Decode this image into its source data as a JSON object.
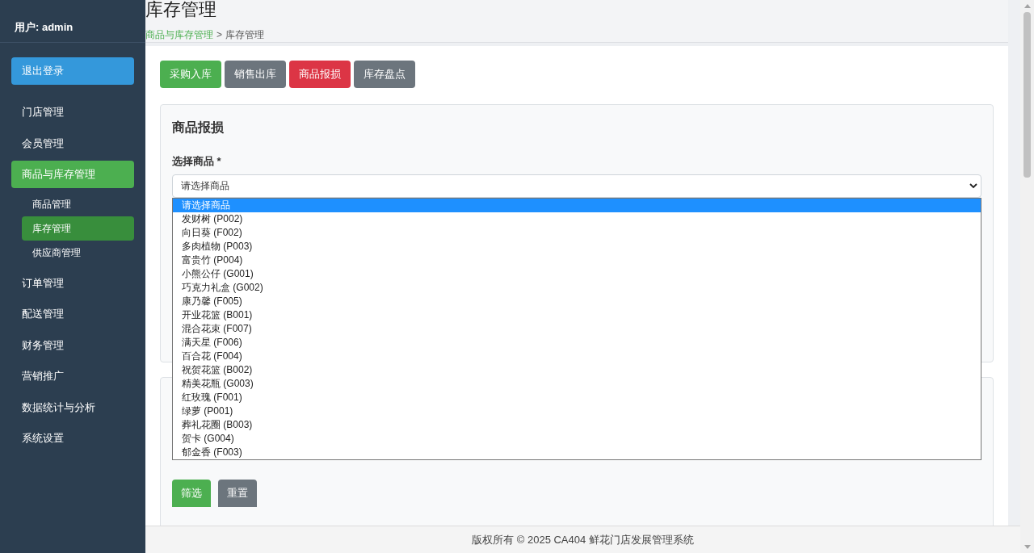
{
  "sidebar": {
    "user": "用户: admin",
    "logout": "退出登录",
    "items": [
      {
        "label": "门店管理",
        "selected": false
      },
      {
        "label": "会员管理",
        "selected": false
      },
      {
        "label": "商品与库存管理",
        "selected": true,
        "children": [
          {
            "label": "商品管理",
            "selected": false
          },
          {
            "label": "库存管理",
            "selected": true
          },
          {
            "label": "供应商管理",
            "selected": false
          }
        ]
      },
      {
        "label": "订单管理",
        "selected": false
      },
      {
        "label": "配送管理",
        "selected": false
      },
      {
        "label": "财务管理",
        "selected": false
      },
      {
        "label": "营销推广",
        "selected": false
      },
      {
        "label": "数据统计与分析",
        "selected": false
      },
      {
        "label": "系统设置",
        "selected": false
      }
    ]
  },
  "header": {
    "title": "库存管理",
    "breadcrumb": [
      {
        "label": "商品与库存管理",
        "kind": "link"
      },
      {
        "label": ">",
        "kind": "separator"
      },
      {
        "label": "库存管理",
        "kind": "current"
      }
    ]
  },
  "actions": [
    {
      "label": "采购入库",
      "color": "#4caf50"
    },
    {
      "label": "销售出库",
      "color": "#6c757d"
    },
    {
      "label": "商品报损",
      "color": "#dc3545"
    },
    {
      "label": "库存盘点",
      "color": "#6c757d"
    }
  ],
  "form": {
    "title": "商品报损",
    "field_label": "选择商品 *",
    "select": {
      "value": "请选择商品",
      "options": [
        {
          "label": "请选择商品",
          "selected": true
        },
        {
          "label": "发财树 (P002)",
          "selected": false
        },
        {
          "label": "向日葵 (F002)",
          "selected": false
        },
        {
          "label": "多肉植物 (P003)",
          "selected": false
        },
        {
          "label": "富贵竹 (P004)",
          "selected": false
        },
        {
          "label": "小熊公仔 (G001)",
          "selected": false
        },
        {
          "label": "巧克力礼盒 (G002)",
          "selected": false
        },
        {
          "label": "康乃馨 (F005)",
          "selected": false
        },
        {
          "label": "开业花篮 (B001)",
          "selected": false
        },
        {
          "label": "混合花束 (F007)",
          "selected": false
        },
        {
          "label": "满天星 (F006)",
          "selected": false
        },
        {
          "label": "百合花 (F004)",
          "selected": false
        },
        {
          "label": "祝贺花篮 (B002)",
          "selected": false
        },
        {
          "label": "精美花瓶 (G003)",
          "selected": false
        },
        {
          "label": "红玫瑰 (F001)",
          "selected": false
        },
        {
          "label": "绿萝 (P001)",
          "selected": false
        },
        {
          "label": "葬礼花圈 (B003)",
          "selected": false
        },
        {
          "label": "贺卡 (G004)",
          "selected": false
        },
        {
          "label": "郁金香 (F003)",
          "selected": false
        }
      ]
    }
  },
  "filter": {
    "buttons": [
      {
        "label": "筛选",
        "color": "#4caf50"
      },
      {
        "label": "重置",
        "color": "#6c757d"
      }
    ]
  },
  "footer": "版权所有 © 2025 CA404 鲜花门店发展管理系统"
}
